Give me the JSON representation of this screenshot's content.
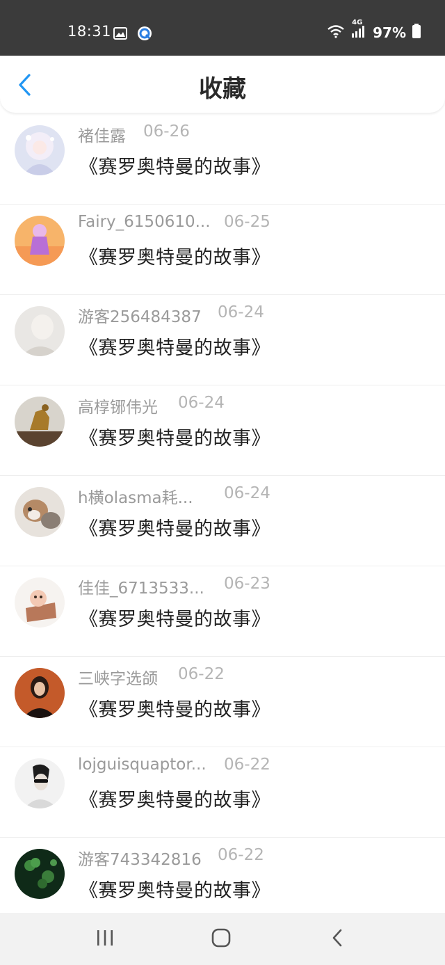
{
  "status_bar": {
    "time": "18:31",
    "battery": "97%",
    "network": "4G",
    "left_icons": [
      "image-icon",
      "app-notification-icon"
    ],
    "right_icons": [
      "wifi-icon",
      "signal-icon",
      "battery-icon"
    ]
  },
  "header": {
    "title": "收藏",
    "back_icon": "chevron-left-icon",
    "accent_color": "#2196f3"
  },
  "items": [
    {
      "user": "褚佳露",
      "date": "06-26",
      "title": "《赛罗奥特曼的故事》"
    },
    {
      "user": "Fairy_6150610...",
      "date": "06-25",
      "title": "《赛罗奥特曼的故事》"
    },
    {
      "user": "游客256484387",
      "date": "06-24",
      "title": "《赛罗奥特曼的故事》"
    },
    {
      "user": "高椁铘伟光",
      "date": "06-24",
      "title": "《赛罗奥特曼的故事》"
    },
    {
      "user": "h横olasma耗...",
      "date": "06-24",
      "title": "《赛罗奥特曼的故事》"
    },
    {
      "user": "佳佳_6713533...",
      "date": "06-23",
      "title": "《赛罗奥特曼的故事》"
    },
    {
      "user": "三峡字选颌",
      "date": "06-22",
      "title": "《赛罗奥特曼的故事》"
    },
    {
      "user": "lojguisquaptor...",
      "date": "06-22",
      "title": "《赛罗奥特曼的故事》"
    },
    {
      "user": "游客743342816",
      "date": "06-22",
      "title": "《赛罗奥特曼的故事》"
    }
  ],
  "nav_bar": {
    "icons": [
      "recent-apps-icon",
      "home-icon",
      "back-icon"
    ]
  }
}
